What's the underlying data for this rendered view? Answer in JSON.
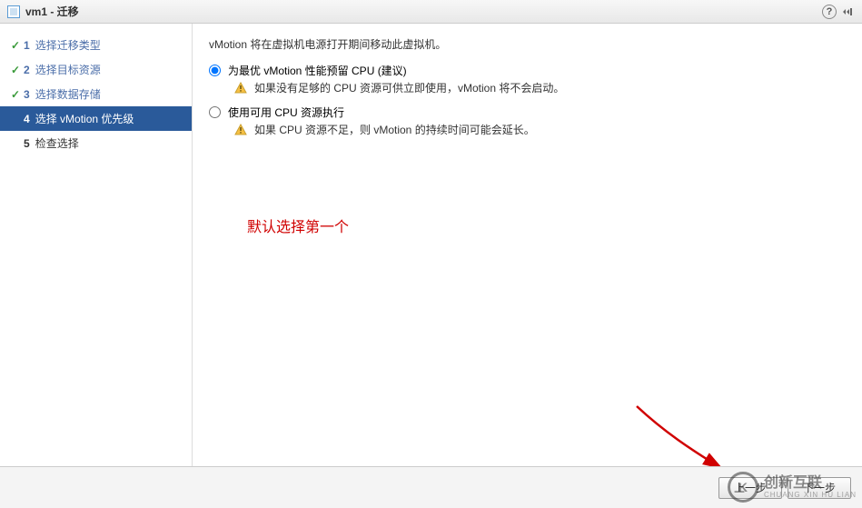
{
  "title": "vm1 - 迁移",
  "steps": [
    {
      "num": "1",
      "label": "选择迁移类型",
      "done": true
    },
    {
      "num": "2",
      "label": "选择目标资源",
      "done": true
    },
    {
      "num": "3",
      "label": "选择数据存储",
      "done": true
    },
    {
      "num": "4",
      "label": "选择 vMotion 优先级",
      "active": true
    },
    {
      "num": "5",
      "label": "检查选择",
      "todo": true
    }
  ],
  "desc": "vMotion 将在虚拟机电源打开期间移动此虚拟机。",
  "opt1": {
    "label": "为最优 vMotion 性能预留 CPU (建议)",
    "note": "如果没有足够的 CPU 资源可供立即使用，vMotion 将不会启动。"
  },
  "opt2": {
    "label": "使用可用 CPU 资源执行",
    "note": "如果 CPU 资源不足，则 vMotion 的持续时间可能会延长。"
  },
  "annotation": "默认选择第一个",
  "buttons": {
    "back": "上一步",
    "next": "下一步"
  },
  "watermark": {
    "brand": "创新互联",
    "sub": "CHUANG XIN HU LIAN"
  }
}
